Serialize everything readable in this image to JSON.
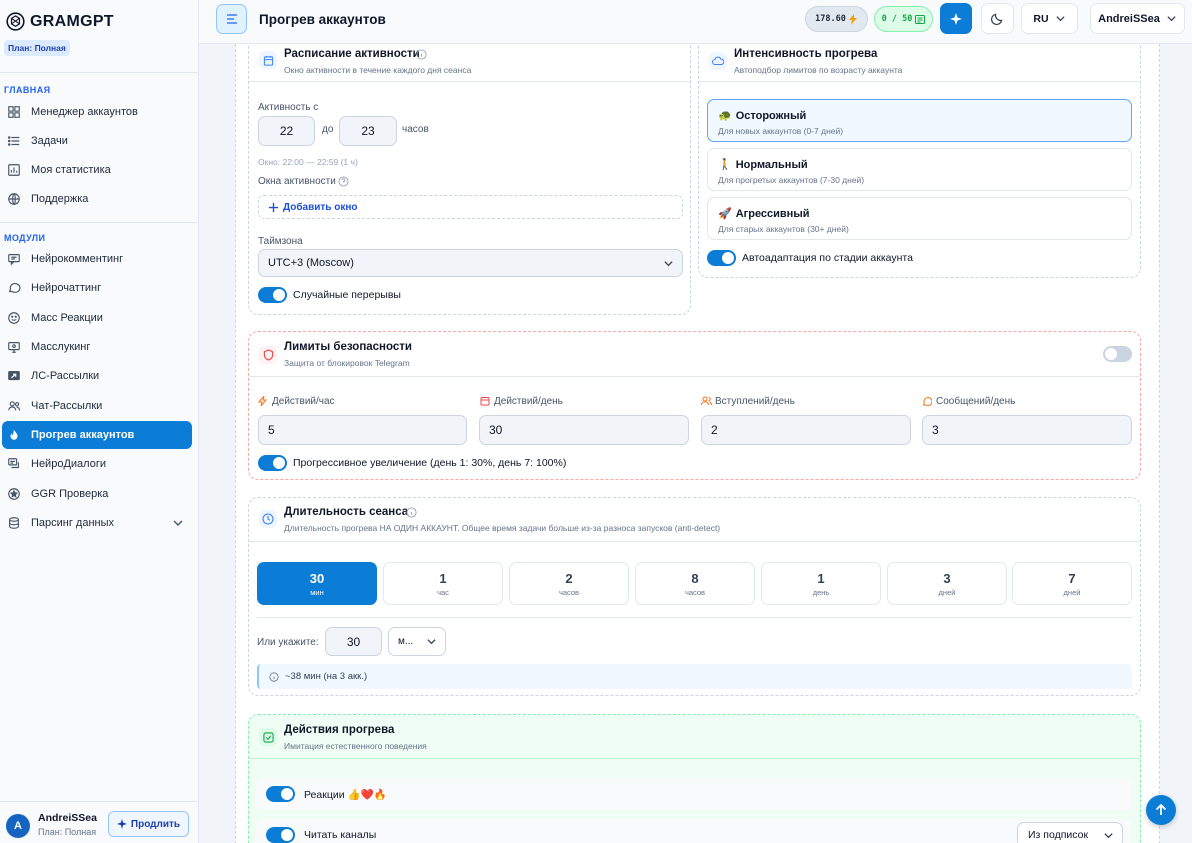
{
  "app": {
    "brand": "GRAMGPT",
    "plan_badge": "План: Полная"
  },
  "sidebar": {
    "section_main": "ГЛАВНАЯ",
    "main_items": [
      {
        "label": "Менеджер аккаунтов",
        "icon": "grid-icon"
      },
      {
        "label": "Задачи",
        "icon": "list-icon"
      },
      {
        "label": "Моя статистика",
        "icon": "chart-icon"
      },
      {
        "label": "Поддержка",
        "icon": "globe-icon"
      }
    ],
    "section_modules": "МОДУЛИ",
    "module_items": [
      {
        "label": "Нейрокомментинг",
        "icon": "comment-icon"
      },
      {
        "label": "Нейрочаттинг",
        "icon": "chat-bubble-icon"
      },
      {
        "label": "Масс Реакции",
        "icon": "smile-icon"
      },
      {
        "label": "Масслукинг",
        "icon": "monitor-icon"
      },
      {
        "label": "ЛС-Рассылки",
        "icon": "send-icon"
      },
      {
        "label": "Чат-Рассылки",
        "icon": "users-icon"
      },
      {
        "label": "Прогрев аккаунтов",
        "icon": "flame-icon",
        "active": true
      },
      {
        "label": "НейроДиалоги",
        "icon": "dialog-icon"
      },
      {
        "label": "GGR Проверка",
        "icon": "badge-icon"
      },
      {
        "label": "Парсинг данных",
        "icon": "database-icon"
      }
    ],
    "user": {
      "initial": "A",
      "name": "AndreiSSea",
      "plan": "План: Полная",
      "extend_label": "Продлить"
    }
  },
  "topbar": {
    "title": "Прогрев аккаунтов",
    "credits": "178.60",
    "quota": "0 / 50",
    "language": "RU",
    "username": "AndreiSSea"
  },
  "schedule": {
    "title": "Расписание активности",
    "subtitle": "Окно активности в течение каждого дня сеанса",
    "activity_from_label": "Активность с",
    "from_value": "22",
    "to_label": "до",
    "to_value": "23",
    "hours_label": "часов",
    "window_info": "Окно: 22:00 — 22:59 (1 ч)",
    "windows_label": "Окна активности",
    "add_window": "Добавить окно",
    "timezone_label": "Таймзона",
    "timezone_value": "UTC+3 (Moscow)",
    "random_breaks": "Случайные перерывы"
  },
  "intensity": {
    "title": "Интенсивность прогрева",
    "subtitle": "Автоподбор лимитов по возрасту аккаунта",
    "options": [
      {
        "emoji": "🐢",
        "title": "Осторожный",
        "desc": "Для новых аккаунтов (0-7 дней)",
        "selected": true
      },
      {
        "emoji": "🚶",
        "title": "Нормальный",
        "desc": "Для прогретых аккаунтов (7-30 дней)"
      },
      {
        "emoji": "🚀",
        "title": "Агрессивный",
        "desc": "Для старых аккаунтов (30+ дней)"
      }
    ],
    "auto_adapt": "Автоадаптация по стадии аккаунта"
  },
  "limits": {
    "title": "Лимиты безопасности",
    "subtitle": "Защита от блокировок Telegram",
    "fields": [
      {
        "label": "Действий/час",
        "value": "5"
      },
      {
        "label": "Действий/день",
        "value": "30"
      },
      {
        "label": "Вступлений/день",
        "value": "2"
      },
      {
        "label": "Сообщений/день",
        "value": "3"
      }
    ],
    "progressive": "Прогрессивное увеличение (день 1: 30%, день 7: 100%)"
  },
  "duration": {
    "title": "Длительность сеанса",
    "subtitle": "Длительность прогрева НА ОДИН АККАУНТ. Общее время задачи больше из-за разноса запусков (anti-detect)",
    "options": [
      {
        "value": "30",
        "unit": "мин",
        "selected": true
      },
      {
        "value": "1",
        "unit": "час"
      },
      {
        "value": "2",
        "unit": "часов"
      },
      {
        "value": "8",
        "unit": "часов"
      },
      {
        "value": "1",
        "unit": "день"
      },
      {
        "value": "3",
        "unit": "дней"
      },
      {
        "value": "7",
        "unit": "дней"
      }
    ],
    "custom_label": "Или укажите:",
    "custom_value": "30",
    "custom_unit": "м...",
    "info": "~38 мин (на 3 акк.)"
  },
  "actions": {
    "title": "Действия прогрева",
    "subtitle": "Имитация естественного поведения",
    "reactions": "Реакции 👍❤️🔥",
    "read_channels": "Читать каналы",
    "read_source": "Из подписок"
  }
}
